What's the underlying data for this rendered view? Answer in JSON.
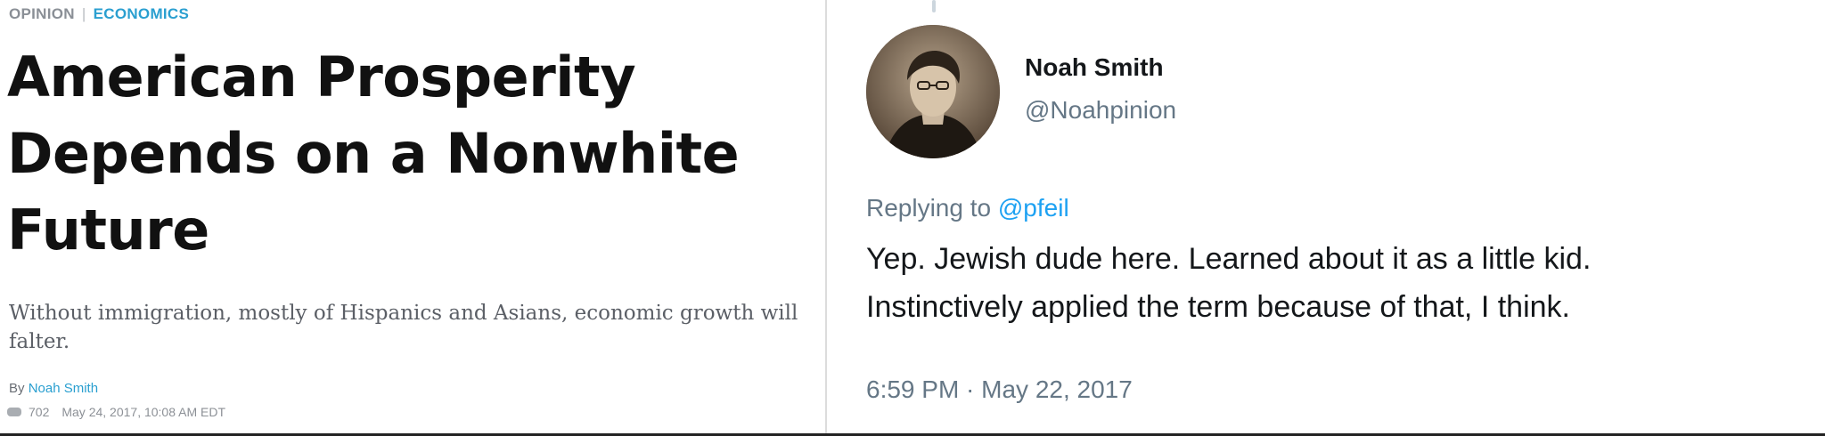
{
  "article": {
    "section": "OPINION",
    "separator": "|",
    "topic": "ECONOMICS",
    "headline_lines": [
      "American Prosperity",
      "Depends on a Nonwhite",
      "Future"
    ],
    "dek": "Without immigration, mostly of Hispanics and Asians, economic growth will falter.",
    "by_prefix": "By",
    "author": "Noah Smith",
    "comment_count": "702",
    "date": "May 24, 2017, 10:08 AM EDT"
  },
  "tweet": {
    "name": "Noah Smith",
    "handle": "@Noahpinion",
    "replying_prefix": "Replying to",
    "replying_to": "@pfeil",
    "text_lines": [
      "Yep. Jewish dude here. Learned about it as a little kid.",
      "Instinctively applied the term because of that, I think."
    ],
    "timestamp": "6:59 PM · May 22, 2017"
  },
  "icons": {
    "comment": "comment-icon",
    "avatar": "avatar-photo"
  },
  "colors": {
    "link_blue": "#2a9fd0",
    "twitter_blue": "#1da1f2",
    "twitter_gray": "#657786"
  }
}
